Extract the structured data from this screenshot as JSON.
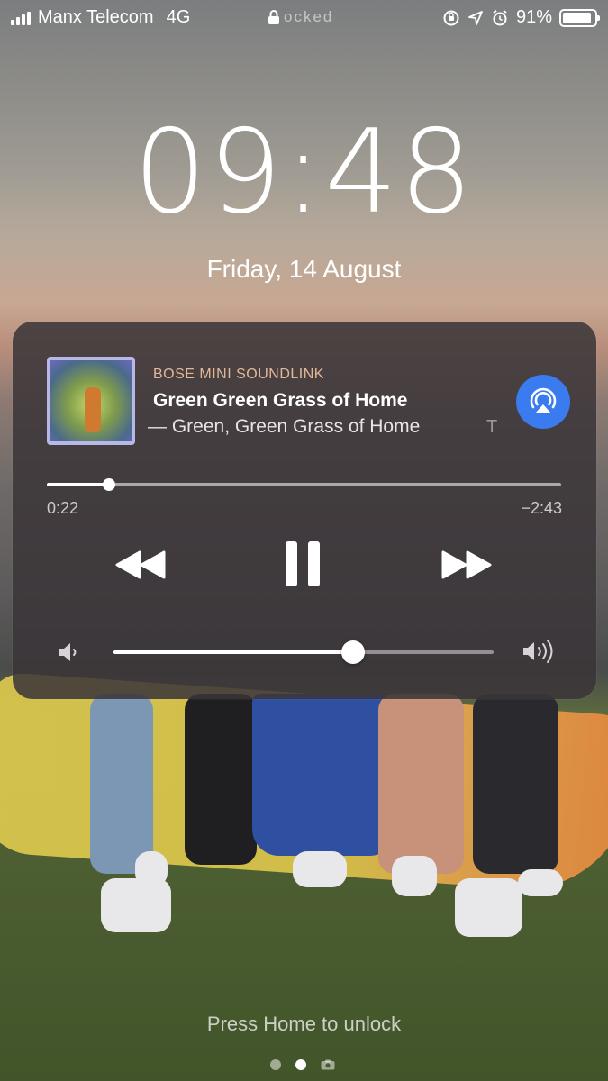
{
  "status_bar": {
    "carrier": "Manx Telecom",
    "network": "4G",
    "lock_text": "ocked",
    "battery": "91%",
    "battery_level": 0.91
  },
  "lockscreen": {
    "time": "09:48",
    "date": "Friday, 14 August",
    "unlock_hint": "Press Home to unlock"
  },
  "player": {
    "device": "BOSE MINI SOUNDLINK",
    "title": "Green Green Grass of Home",
    "subtitle": "— Green, Green Grass of Home",
    "subtitle_overflow": "T",
    "elapsed": "0:22",
    "remaining": "−2:43",
    "progress": 0.12,
    "volume": 0.63,
    "icons": {
      "artwork": "album-artwork",
      "airplay": "airplay-icon",
      "rewind": "rewind-icon",
      "pause": "pause-icon",
      "forward": "fast-forward-icon",
      "volume_low": "volume-low-icon",
      "volume_high": "volume-high-icon"
    },
    "accent_color": "#3a7bf0"
  },
  "page_indicator": {
    "count": 3,
    "active_index": 1
  }
}
